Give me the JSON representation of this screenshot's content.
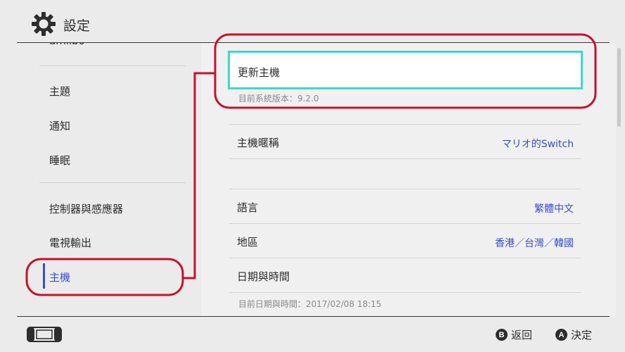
{
  "header": {
    "title": "設定",
    "icon": "gear-icon"
  },
  "sidebar": {
    "items": [
      {
        "label": "amiibo"
      },
      {
        "label": "主題"
      },
      {
        "label": "通知"
      },
      {
        "label": "睡眠"
      },
      {
        "label": "控制器與感應器"
      },
      {
        "label": "電視輸出"
      },
      {
        "label": "主機",
        "active": true
      }
    ]
  },
  "main": {
    "update": {
      "label": "更新主機",
      "sub": "目前系統版本：9.2.0"
    },
    "nickname": {
      "label": "主機暱稱",
      "value": "マリオ的Switch"
    },
    "language": {
      "label": "語言",
      "value": "繁體中文"
    },
    "region": {
      "label": "地區",
      "value": "香港／台灣／韓國"
    },
    "datetime": {
      "label": "日期與時間",
      "sub": "目前日期與時間：2017/02/08 18:15"
    }
  },
  "footer": {
    "back": {
      "key": "B",
      "label": "返回"
    },
    "ok": {
      "key": "A",
      "label": "決定"
    }
  },
  "colors": {
    "accent": "#3a4fc4",
    "selection": "#3fd8c9",
    "annotation": "#c4122e",
    "background": "#ebebeb"
  }
}
